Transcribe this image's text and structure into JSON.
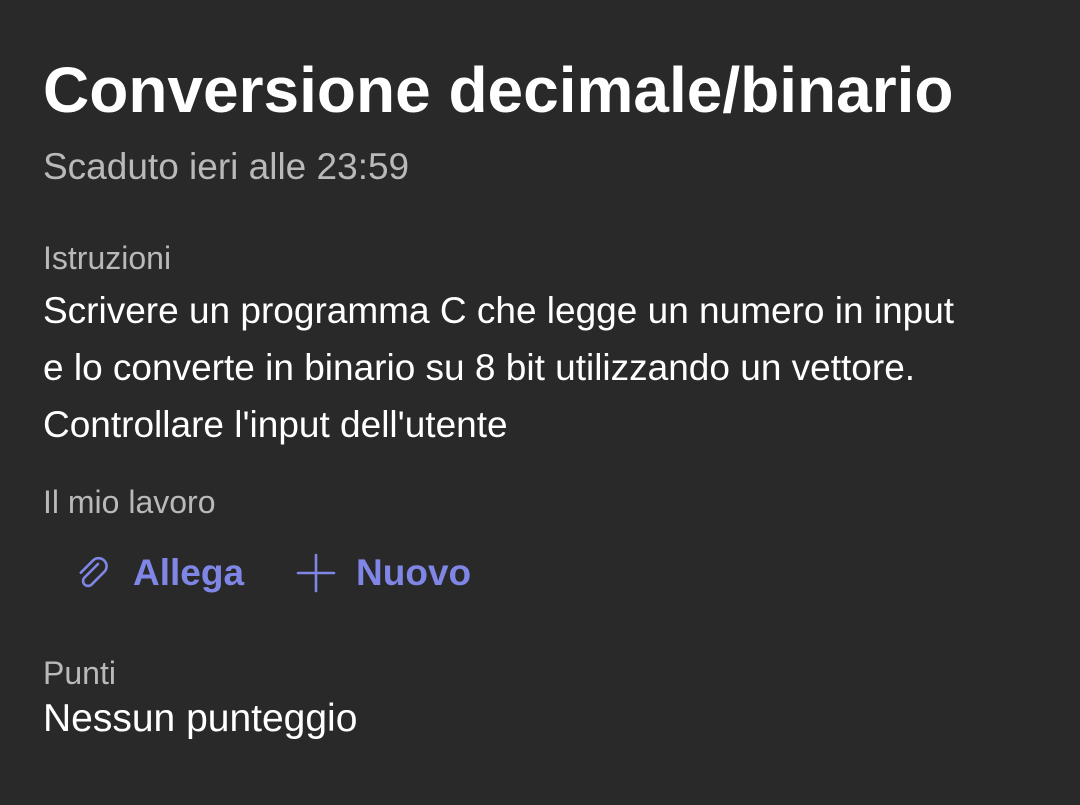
{
  "assignment": {
    "title": "Conversione decimale/binario",
    "due": "Scaduto ieri alle 23:59"
  },
  "instructions": {
    "label": "Istruzioni",
    "lines": [
      "Scrivere un programma C che legge un numero in input",
      "e lo converte in binario su 8 bit utilizzando un vettore.",
      "Controllare l'input dell'utente"
    ]
  },
  "work": {
    "label": "Il mio lavoro",
    "attach_label": "Allega",
    "attach_icon": "paperclip-icon",
    "new_label": "Nuovo",
    "new_icon": "plus-icon",
    "accent_color": "#7f86e5"
  },
  "points": {
    "label": "Punti",
    "value": "Nessun punteggio"
  },
  "theme": {
    "background": "#292929",
    "primary_text": "#ffffff",
    "secondary_text": "#b9b9b9"
  }
}
